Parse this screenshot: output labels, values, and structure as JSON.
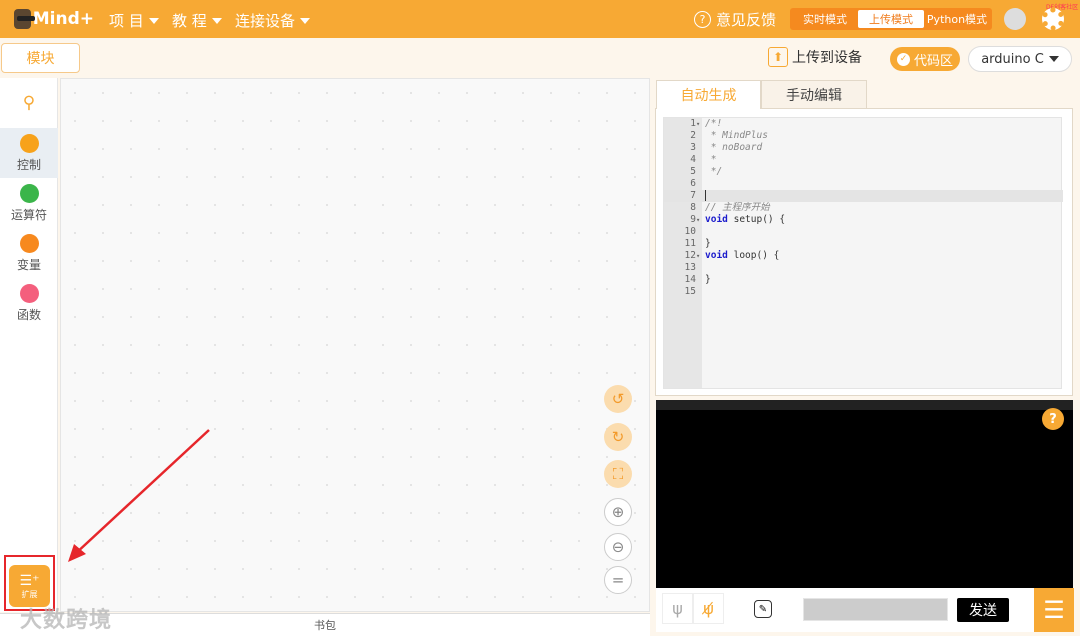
{
  "header": {
    "logo_text": "Mind+",
    "menus": [
      {
        "label": "项 目"
      },
      {
        "label": "教 程"
      },
      {
        "label": "连接设备"
      }
    ],
    "feedback": "意见反馈",
    "modes": [
      {
        "label": "实时模式",
        "active": false
      },
      {
        "label": "上传模式",
        "active": true
      },
      {
        "label": "Python模式",
        "active": false
      }
    ],
    "brand_badge": "DF创客社区"
  },
  "subbar": {
    "blocks_tab": "模块",
    "upload": "上传到设备",
    "code_area": "代码区",
    "language": "arduino C"
  },
  "sidebar": {
    "search_icon": "search-icon",
    "categories": [
      {
        "label": "控制",
        "color": "#f7a21b",
        "active": true
      },
      {
        "label": "运算符",
        "color": "#3bb54a"
      },
      {
        "label": "变量",
        "color": "#f7891e"
      },
      {
        "label": "函数",
        "color": "#f45f7d"
      }
    ],
    "extension": "扩展"
  },
  "canvas": {
    "controls": [
      "undo-icon",
      "redo-icon",
      "crop-icon",
      "zoom-in-icon",
      "zoom-out-icon",
      "reset-zoom-icon"
    ],
    "backpack": "书包"
  },
  "code": {
    "tabs": [
      {
        "label": "自动生成",
        "active": true
      },
      {
        "label": "手动编辑"
      }
    ],
    "lines": [
      {
        "n": "1",
        "t": "/*!",
        "c": "cm",
        "fold": true
      },
      {
        "n": "2",
        "t": " * MindPlus",
        "c": "cm"
      },
      {
        "n": "3",
        "t": " * noBoard",
        "c": "cm"
      },
      {
        "n": "4",
        "t": " *",
        "c": "cm"
      },
      {
        "n": "5",
        "t": " */",
        "c": "cm"
      },
      {
        "n": "6",
        "t": ""
      },
      {
        "n": "7",
        "t": "",
        "active": true
      },
      {
        "n": "8",
        "t": "// 主程序开始",
        "c": "cm"
      },
      {
        "n": "9",
        "kw": "void",
        "t": " setup() {",
        "fold": true
      },
      {
        "n": "10",
        "t": ""
      },
      {
        "n": "11",
        "t": "}"
      },
      {
        "n": "12",
        "kw": "void",
        "t": " loop() {",
        "fold": true
      },
      {
        "n": "13",
        "t": ""
      },
      {
        "n": "14",
        "t": "}"
      },
      {
        "n": "15",
        "t": ""
      }
    ]
  },
  "console": {
    "send": "发送",
    "input_value": ""
  },
  "watermark": "大数跨境",
  "colors": {
    "accent": "#f7a934",
    "mode_bg": "#f58a1f"
  }
}
